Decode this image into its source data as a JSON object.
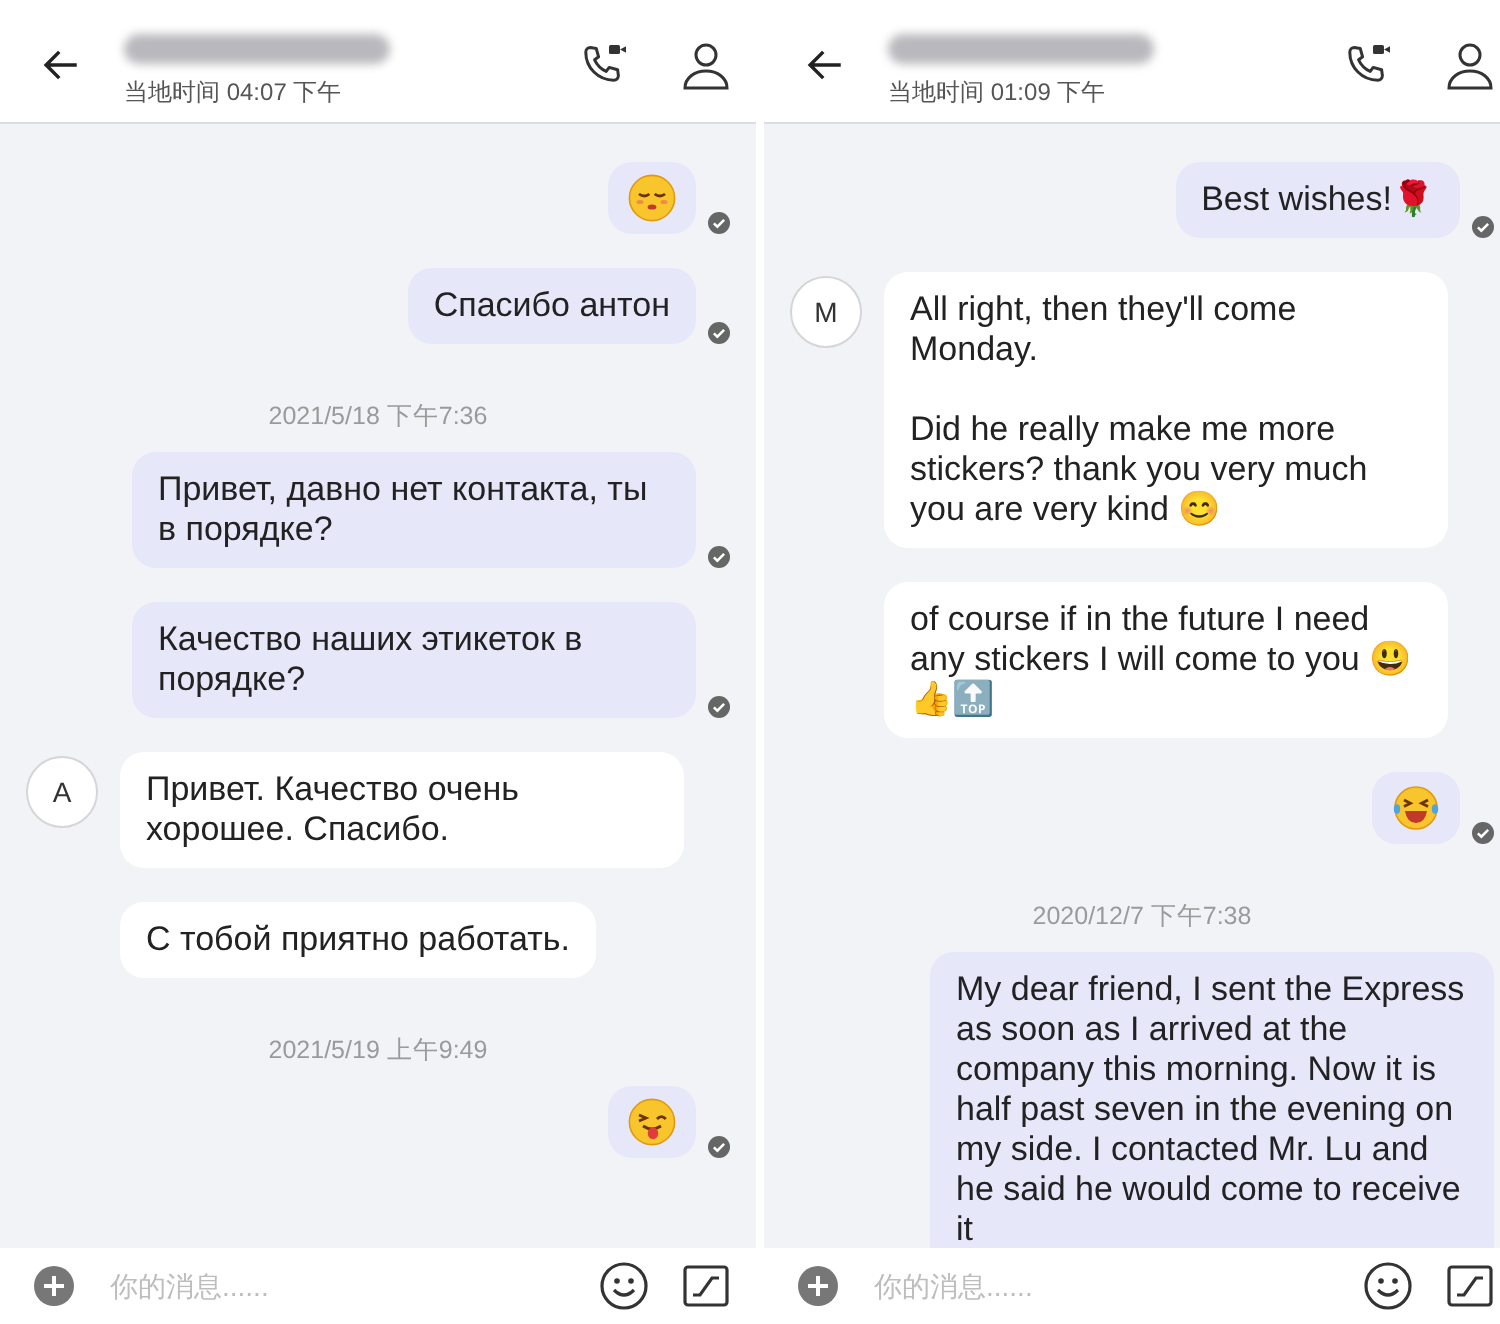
{
  "panels": [
    {
      "header": {
        "name_blurred": true,
        "subtitle": "当地时间 04:07 下午"
      },
      "items": [
        {
          "kind": "sleepy",
          "outgoing": true,
          "delivered": true
        },
        {
          "kind": "message",
          "outgoing": true,
          "delivered": true,
          "text": "Спасибо антон"
        },
        {
          "kind": "date",
          "text": "2021/5/18 下午7:36"
        },
        {
          "kind": "message",
          "outgoing": true,
          "delivered": true,
          "text": "Привет, давно нет контакта, ты в порядке?"
        },
        {
          "kind": "message",
          "outgoing": true,
          "delivered": true,
          "text": "Качество наших этикеток в порядке?"
        },
        {
          "kind": "message",
          "outgoing": false,
          "delivered": false,
          "avatar": "A",
          "text": "Привет. Качество очень хорошее. Спасибо."
        },
        {
          "kind": "message",
          "outgoing": false,
          "delivered": false,
          "text": "С тобой приятно работать."
        },
        {
          "kind": "date",
          "text": "2021/5/19 上午9:49"
        },
        {
          "kind": "tongue",
          "outgoing": true,
          "delivered": true
        }
      ],
      "composer": {
        "placeholder": "你的消息......"
      }
    },
    {
      "header": {
        "name_blurred": true,
        "subtitle": "当地时间 01:09 下午"
      },
      "items": [
        {
          "kind": "message",
          "outgoing": true,
          "delivered": true,
          "text": "Best wishes!🌹"
        },
        {
          "kind": "message",
          "outgoing": false,
          "delivered": false,
          "avatar": "M",
          "text": "All right, then they'll come Monday.\n\nDid he really make me more stickers? thank you very much you are very kind 😊"
        },
        {
          "kind": "message",
          "outgoing": false,
          "delivered": false,
          "text": "of course if in the future I need any stickers I will come to you 😃👍🔝"
        },
        {
          "kind": "laughing",
          "outgoing": true,
          "delivered": true
        },
        {
          "kind": "date",
          "text": "2020/12/7 下午7:38"
        },
        {
          "kind": "message",
          "outgoing": true,
          "delivered": false,
          "text": "My dear friend, I sent the Express as soon as I arrived at the company this morning. Now it is half past seven in the evening on my side. I contacted Mr. Lu and he said he would come to receive it"
        }
      ],
      "composer": {
        "placeholder": "你的消息......"
      }
    }
  ]
}
